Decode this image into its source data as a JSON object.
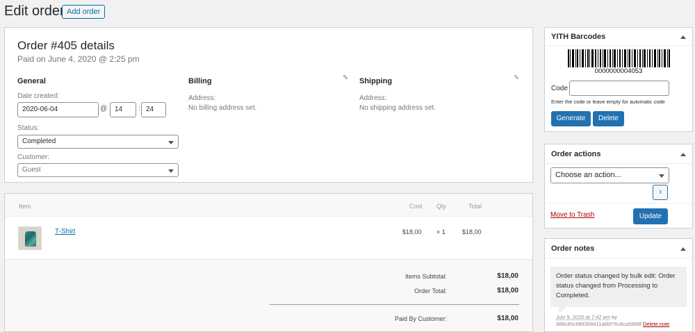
{
  "header": {
    "title": "Edit order",
    "add_order_label": "Add order"
  },
  "order": {
    "heading": "Order #405 details",
    "paid_on": "Paid on June 4, 2020 @ 2:25 pm",
    "general": {
      "title": "General",
      "date_created_label": "Date created:",
      "date_value": "2020-06-04",
      "at_symbol": "@",
      "hour_value": "14",
      "time_separator": ":",
      "minute_value": "24",
      "status_label": "Status:",
      "status_value": "Completed",
      "customer_label": "Customer:",
      "customer_value": "Guest"
    },
    "billing": {
      "title": "Billing",
      "address_label": "Address:",
      "address_value": "No billing address set."
    },
    "shipping": {
      "title": "Shipping",
      "address_label": "Address:",
      "address_value": "No shipping address set."
    }
  },
  "items": {
    "columns": {
      "item": "Item",
      "cost": "Cost",
      "qty": "Qty",
      "total": "Total"
    },
    "rows": [
      {
        "name": "T-Shirt",
        "cost": "$18,00",
        "qty": "× 1",
        "total": "$18,00"
      }
    ],
    "totals": {
      "subtotal_label": "Items Subtotal:",
      "subtotal_value": "$18,00",
      "order_total_label": "Order Total:",
      "order_total_value": "$18,00",
      "paid_label": "Paid By Customer:",
      "paid_value": "$18,00"
    }
  },
  "barcodes": {
    "title": "YITH Barcodes",
    "barcode_number": "0000000004053",
    "code_label": "Code",
    "code_value": "",
    "help_text": "Enter the code or leave empty for automatic code",
    "generate_label": "Generate",
    "delete_label": "Delete"
  },
  "order_actions": {
    "title": "Order actions",
    "select_value": "Choose an action...",
    "go_label": "›",
    "trash_label": "Move to Trash",
    "update_label": "Update"
  },
  "order_notes": {
    "title": "Order notes",
    "note_text": "Order status changed by bulk edit: Order status changed from Processing to Completed.",
    "note_date": "July 9, 2020 at 7:42 pm",
    "note_by": "by",
    "note_author": "988c85c6fbf308411a6bf76c8ca5868f",
    "delete_note_label": "Delete note"
  },
  "colors": {
    "accent": "#2271b1",
    "link": "#0073aa",
    "danger": "#a00000",
    "background": "#f1f1f1"
  }
}
